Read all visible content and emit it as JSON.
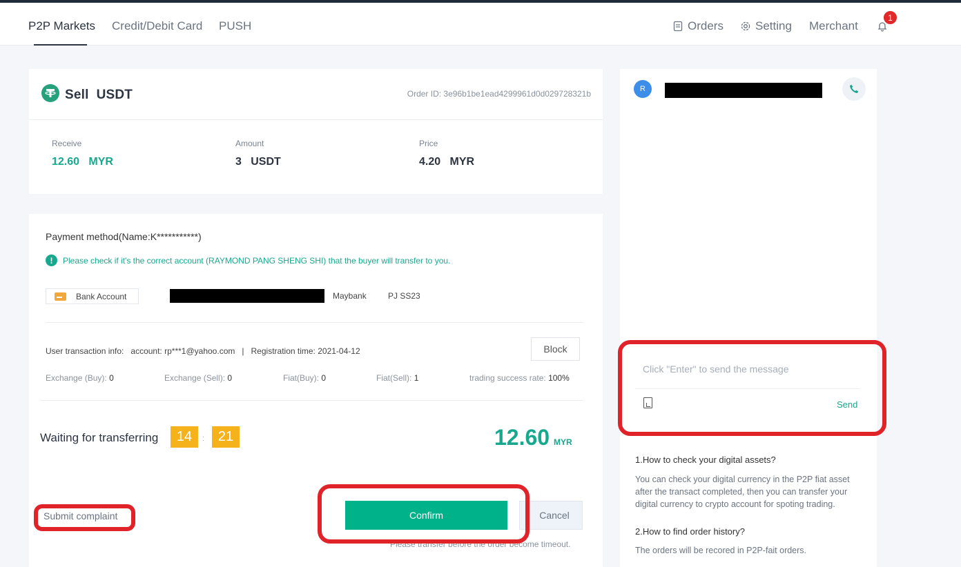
{
  "nav": {
    "tabs": [
      "P2P Markets",
      "Credit/Debit Card",
      "PUSH"
    ],
    "orders": "Orders",
    "setting": "Setting",
    "merchant": "Merchant",
    "notification_count": "1"
  },
  "order": {
    "side": "Sell",
    "asset": "USDT",
    "order_id": "Order ID:  3e96b1be1ead4299961d0d029728321b",
    "receive_label": "Receive",
    "receive_value": "12.60",
    "receive_unit": "MYR",
    "amount_label": "Amount",
    "amount_value": "3",
    "amount_unit": "USDT",
    "price_label": "Price",
    "price_value": "4.20",
    "price_unit": "MYR"
  },
  "payment": {
    "title": "Payment method(Name:K***********)",
    "note": "Please check if it's the correct account (RAYMOND PANG SHENG SHI) that the buyer will transfer to you.",
    "method_label": "Bank Account",
    "bank": "Maybank",
    "branch": "PJ SS23"
  },
  "user_info": {
    "label": "User transaction info:",
    "account_label": "account:",
    "account_value": "rp***1@yahoo.com",
    "separator": "|",
    "reg_label": "Registration time:",
    "reg_value": "2021-04-12",
    "block_label": "Block",
    "exchange_buy_label": "Exchange (Buy):",
    "exchange_buy": "0",
    "exchange_sell_label": "Exchange (Sell):",
    "exchange_sell": "0",
    "fiat_buy_label": "Fiat(Buy):",
    "fiat_buy": "0",
    "fiat_sell_label": "Fiat(Sell):",
    "fiat_sell": "1",
    "success_label": "trading success rate:",
    "success_rate": "100%"
  },
  "transfer": {
    "waiting_label": "Waiting for transferring",
    "minutes": "14",
    "colon": ":",
    "seconds": "21",
    "amount": "12.60",
    "unit": "MYR",
    "complaint_label": "Submit complaint",
    "confirm_label": "Confirm",
    "cancel_label": "Cancel",
    "timeout_note": "Please transfer before the order become timeout."
  },
  "chat": {
    "avatar_letter": "R",
    "placeholder": "Click \"Enter\" to send the message",
    "send_label": "Send"
  },
  "faq": [
    {
      "q": "1.How to check your digital assets?",
      "a": "You can check your digital currency in the P2P fiat asset after the transact completed, then you can transfer your digital currency to crypto account for spoting trading."
    },
    {
      "q": "2.How to find order history?",
      "a": "The orders will be recored in P2P-fait orders."
    }
  ],
  "colors": {
    "accent": "#17a88e",
    "confirm": "#00b28a",
    "timer": "#f5b21b",
    "highlight": "#e02229"
  }
}
